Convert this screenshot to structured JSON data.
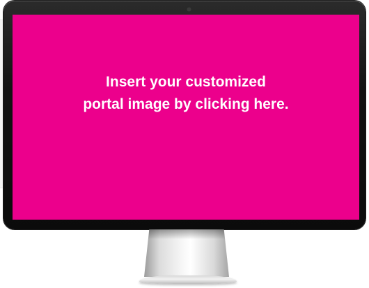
{
  "portal": {
    "line1": "Insert your customized",
    "line2": "portal image by clicking here.",
    "screen_color": "#ec008c",
    "text_color": "#ffffff"
  },
  "icons": {
    "camera": "camera-dot-icon"
  }
}
